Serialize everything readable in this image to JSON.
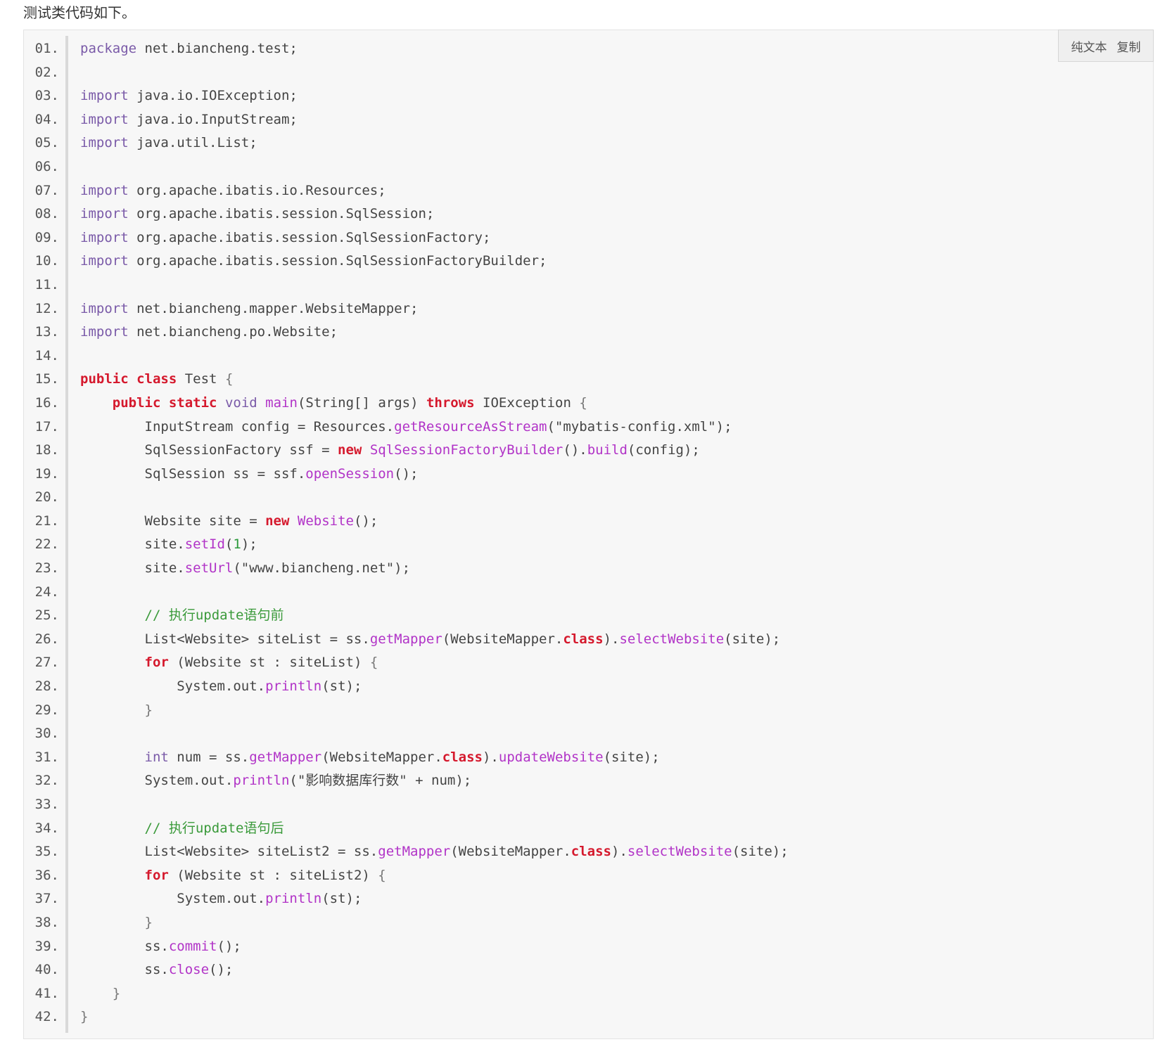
{
  "intro_text": "测试类代码如下。",
  "toolbar": {
    "plain_text_label": "纯文本",
    "copy_label": "复制"
  },
  "code_lines": [
    {
      "n": "01.",
      "html": "<span class='kw'>package</span> net.biancheng.test;"
    },
    {
      "n": "02.",
      "html": ""
    },
    {
      "n": "03.",
      "html": "<span class='kw'>import</span> java.io.IOException;"
    },
    {
      "n": "04.",
      "html": "<span class='kw'>import</span> java.io.InputStream;"
    },
    {
      "n": "05.",
      "html": "<span class='kw'>import</span> java.util.List;"
    },
    {
      "n": "06.",
      "html": ""
    },
    {
      "n": "07.",
      "html": "<span class='kw'>import</span> org.apache.ibatis.io.Resources;"
    },
    {
      "n": "08.",
      "html": "<span class='kw'>import</span> org.apache.ibatis.session.SqlSession;"
    },
    {
      "n": "09.",
      "html": "<span class='kw'>import</span> org.apache.ibatis.session.SqlSessionFactory;"
    },
    {
      "n": "10.",
      "html": "<span class='kw'>import</span> org.apache.ibatis.session.SqlSessionFactoryBuilder;"
    },
    {
      "n": "11.",
      "html": ""
    },
    {
      "n": "12.",
      "html": "<span class='kw'>import</span> net.biancheng.mapper.WebsiteMapper;"
    },
    {
      "n": "13.",
      "html": "<span class='kw'>import</span> net.biancheng.po.Website;"
    },
    {
      "n": "14.",
      "html": ""
    },
    {
      "n": "15.",
      "html": "<span class='kw-strong'>public</span> <span class='kw-strong'>class</span> Test <span class='punc'>{</span>"
    },
    {
      "n": "16.",
      "html": "    <span class='kw-strong'>public</span> <span class='kw-strong'>static</span> <span class='kw'>void</span> <span class='fn'>main</span>(String[] args) <span class='kw-strong'>throws</span> IOException <span class='punc'>{</span>"
    },
    {
      "n": "17.",
      "html": "        InputStream config = Resources.<span class='fn'>getResourceAsStream</span>(\"mybatis-config.xml\");"
    },
    {
      "n": "18.",
      "html": "        SqlSessionFactory ssf = <span class='kw-strong'>new</span> <span class='fn'>SqlSessionFactoryBuilder</span>().<span class='fn'>build</span>(config);"
    },
    {
      "n": "19.",
      "html": "        SqlSession ss = ssf.<span class='fn'>openSession</span>();"
    },
    {
      "n": "20.",
      "html": ""
    },
    {
      "n": "21.",
      "html": "        Website site = <span class='kw-strong'>new</span> <span class='fn'>Website</span>();"
    },
    {
      "n": "22.",
      "html": "        site.<span class='fn'>setId</span>(<span class='num'>1</span>);"
    },
    {
      "n": "23.",
      "html": "        site.<span class='fn'>setUrl</span>(\"www.biancheng.net\");"
    },
    {
      "n": "24.",
      "html": ""
    },
    {
      "n": "25.",
      "html": "        <span class='cmt'>// 执行update语句前</span>"
    },
    {
      "n": "26.",
      "html": "        List&lt;Website&gt; siteList = ss.<span class='fn'>getMapper</span>(WebsiteMapper.<span class='kw-strong'>class</span>).<span class='fn'>selectWebsite</span>(site);"
    },
    {
      "n": "27.",
      "html": "        <span class='kw-strong'>for</span> (Website st : siteList) <span class='punc'>{</span>"
    },
    {
      "n": "28.",
      "html": "            System.out.<span class='fn'>println</span>(st);"
    },
    {
      "n": "29.",
      "html": "        <span class='punc'>}</span>"
    },
    {
      "n": "30.",
      "html": ""
    },
    {
      "n": "31.",
      "html": "        <span class='kw'>int</span> num = ss.<span class='fn'>getMapper</span>(WebsiteMapper.<span class='kw-strong'>class</span>).<span class='fn'>updateWebsite</span>(site);"
    },
    {
      "n": "32.",
      "html": "        System.out.<span class='fn'>println</span>(\"影响数据库行数\" + num);"
    },
    {
      "n": "33.",
      "html": ""
    },
    {
      "n": "34.",
      "html": "        <span class='cmt'>// 执行update语句后</span>"
    },
    {
      "n": "35.",
      "html": "        List&lt;Website&gt; siteList2 = ss.<span class='fn'>getMapper</span>(WebsiteMapper.<span class='kw-strong'>class</span>).<span class='fn'>selectWebsite</span>(site);"
    },
    {
      "n": "36.",
      "html": "        <span class='kw-strong'>for</span> (Website st : siteList2) <span class='punc'>{</span>"
    },
    {
      "n": "37.",
      "html": "            System.out.<span class='fn'>println</span>(st);"
    },
    {
      "n": "38.",
      "html": "        <span class='punc'>}</span>"
    },
    {
      "n": "39.",
      "html": "        ss.<span class='fn'>commit</span>();"
    },
    {
      "n": "40.",
      "html": "        ss.<span class='fn'>close</span>();"
    },
    {
      "n": "41.",
      "html": "    <span class='punc'>}</span>"
    },
    {
      "n": "42.",
      "html": "<span class='punc'>}</span>"
    }
  ]
}
